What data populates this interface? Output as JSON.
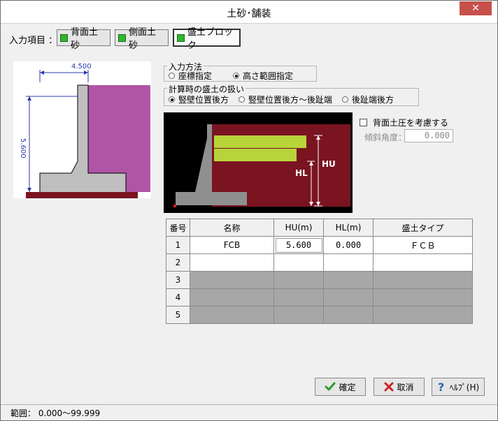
{
  "window": {
    "title": "土砂･舗装",
    "close": "✕"
  },
  "input_items": {
    "label": "入力項目 ：",
    "tabs": [
      {
        "label": "背面土砂"
      },
      {
        "label": "側面土砂"
      },
      {
        "label": "盛土ブロック"
      }
    ]
  },
  "preview": {
    "width_dim": "4.500",
    "height_dim": "5.600"
  },
  "input_method": {
    "label": "入力方法",
    "options": [
      "座標指定",
      "高さ範囲指定"
    ],
    "selected": 1
  },
  "calc_handling": {
    "label": "計算時の盛土の扱い",
    "options": [
      "竪壁位置後方",
      "竪壁位置後方～後趾端",
      "後趾端後方"
    ],
    "selected": 0
  },
  "diagram": {
    "hu_label": "HU",
    "hl_label": "HL"
  },
  "back_pressure": {
    "checkbox_label": "背面土圧を考慮する",
    "checked": false,
    "angle_label": "傾斜角度：",
    "angle_value": "0.000"
  },
  "table": {
    "headers": [
      "番号",
      "名称",
      "HU(m)",
      "HL(m)",
      "盛土タイプ"
    ],
    "rows": [
      [
        "1",
        "FCB",
        "5.600",
        "0.000",
        "ＦＣＢ"
      ],
      [
        "2",
        "",
        "",
        "",
        ""
      ],
      [
        "3",
        "",
        "",
        "",
        ""
      ],
      [
        "4",
        "",
        "",
        "",
        ""
      ],
      [
        "5",
        "",
        "",
        "",
        ""
      ]
    ]
  },
  "buttons": {
    "ok": "確定",
    "cancel": "取消",
    "help": "ﾍﾙﾌﾟ(H)"
  },
  "status": {
    "range": "範囲： 0.000～99.999"
  },
  "colors": {
    "fill_purple": "#b054a6",
    "fill_maroon": "#7a1420",
    "block_green": "#b8d43a",
    "wall_gray": "#c0bfbf"
  }
}
